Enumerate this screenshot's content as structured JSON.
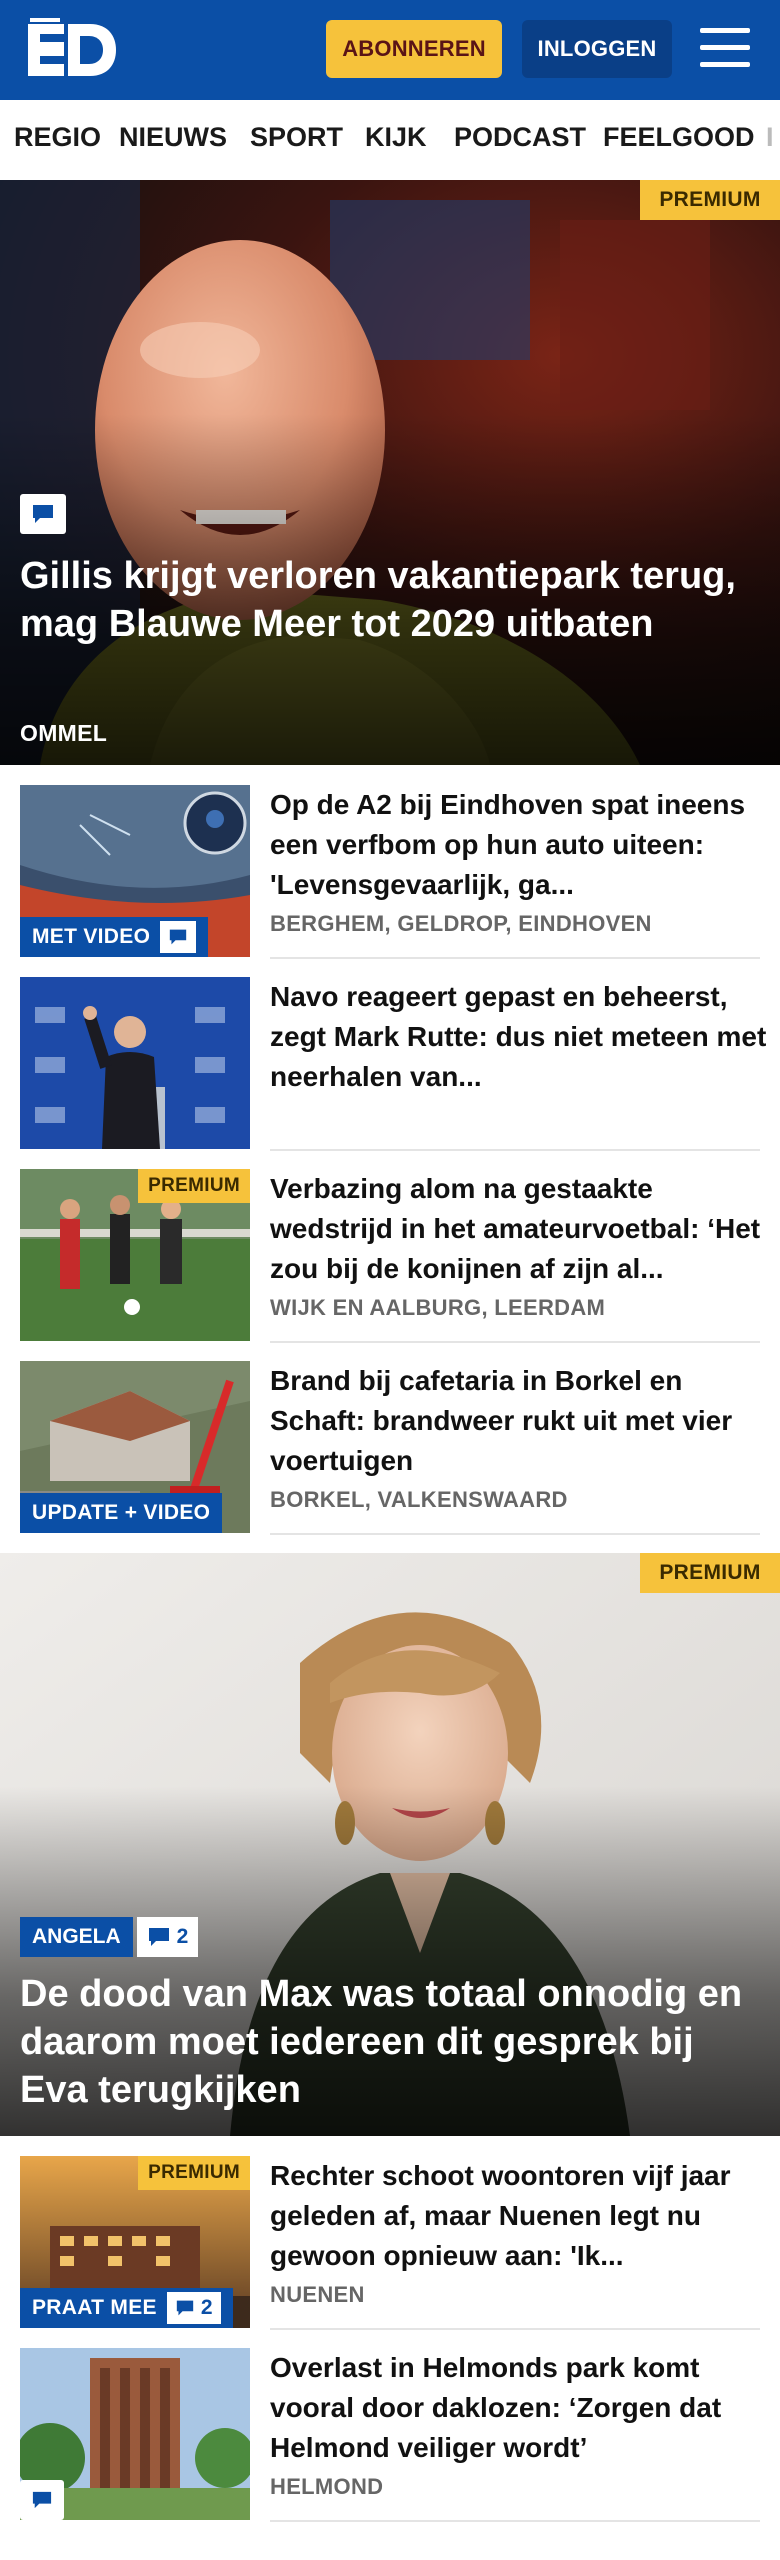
{
  "header": {
    "logo_text": "ED",
    "subscribe_label": "ABONNEREN",
    "login_label": "INLOGGEN",
    "menu_icon": "hamburger-menu-icon"
  },
  "nav": {
    "items": [
      "REGIO",
      "NIEUWS",
      "SPORT",
      "KIJK",
      "PODCAST",
      "FEELGOOD",
      "I"
    ]
  },
  "hero1": {
    "premium": "PREMIUM",
    "title": "Gillis krijgt verloren vakantiepark terug, mag Blauwe Meer tot 2029 uitbaten",
    "location": "OMMEL"
  },
  "articles1": [
    {
      "title": "Op de A2 bij Eindhoven spat ineens een verfbom op hun auto uiteen: 'Levensgevaarlijk, ga...",
      "location": "BERGHEM, GELDROP, EINDHOVEN",
      "badge": "MET VIDEO"
    },
    {
      "title": "Navo reageert gepast en beheerst, zegt Mark Rutte: dus niet meteen met neerhalen van..."
    },
    {
      "title": "Verbazing alom na gestaakte wedstrijd in het amateurvoetbal: ‘Het zou bij de konijnen af zijn al...",
      "location": "WIJK EN AALBURG, LEERDAM",
      "premium": "PREMIUM"
    },
    {
      "title": "Brand bij cafetaria in Borkel en Schaft: brandweer rukt uit met vier voertuigen",
      "location": "BORKEL, VALKENSWAARD",
      "badge": "UPDATE + VIDEO"
    }
  ],
  "hero2": {
    "premium": "PREMIUM",
    "badge": "ANGELA",
    "comment_count": "2",
    "title": "De dood van Max was totaal onnodig en daarom moet iedereen dit gesprek bij Eva terugkijken"
  },
  "articles2": [
    {
      "title": "Rechter schoot woontoren vijf jaar geleden af, maar Nuenen legt nu gewoon opnieuw aan: 'Ik...",
      "location": "NUENEN",
      "badge": "PRAAT MEE",
      "comment_count": "2",
      "premium": "PREMIUM"
    },
    {
      "title": "Overlast in Helmonds park komt vooral door daklozen: ‘Zorgen dat Helmond veiliger wordt’",
      "location": "HELMOND"
    }
  ],
  "colors": {
    "brand_blue": "#0b4fa6",
    "premium_yellow": "#f6c23b",
    "subscribe_text": "#5a1416",
    "login_bg": "#0a3f87"
  }
}
